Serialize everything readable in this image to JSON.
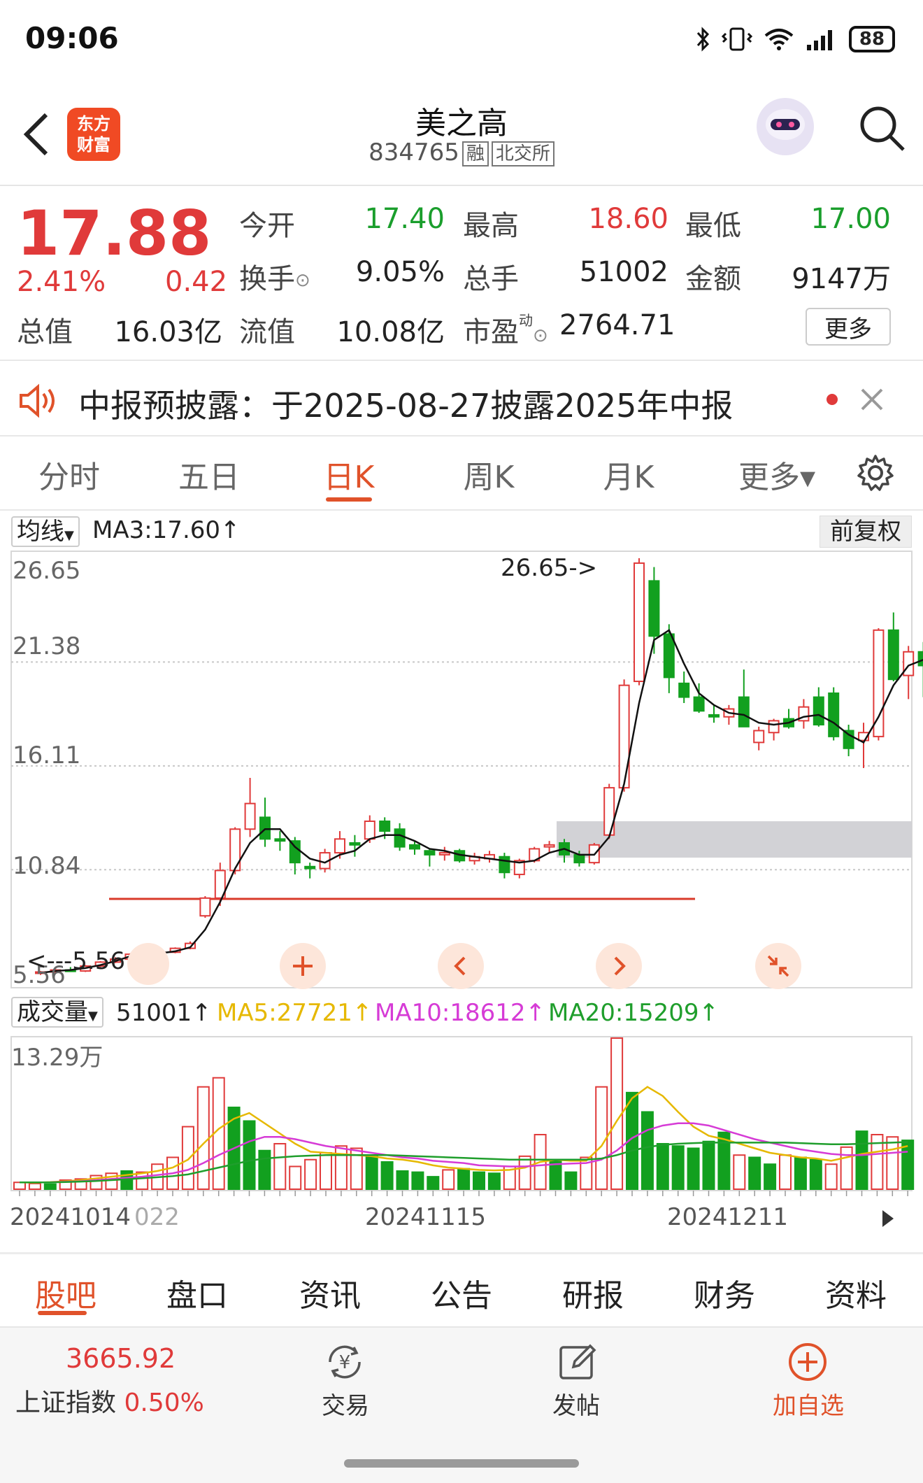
{
  "status_bar": {
    "time": "09:06",
    "battery": "88"
  },
  "header": {
    "logo_line1": "东方",
    "logo_line2": "财富",
    "stock_name": "美之高",
    "stock_code": "834765",
    "tag_margin": "融",
    "tag_exchange": "北交所"
  },
  "quote": {
    "price": "17.88",
    "change_pct": "2.41%",
    "change_abs": "0.42",
    "fields": [
      {
        "label": "今开",
        "value": "17.40",
        "color": "#1a9e2c"
      },
      {
        "label": "最高",
        "value": "18.60",
        "color": "#e03a3a"
      },
      {
        "label": "最低",
        "value": "17.00",
        "color": "#1a9e2c"
      },
      {
        "label": "换手",
        "value": "9.05%",
        "color": "#222222"
      },
      {
        "label": "总手",
        "value": "51002",
        "color": "#222222"
      },
      {
        "label": "金额",
        "value": "9147万",
        "color": "#222222"
      }
    ],
    "total_value_label": "总值",
    "total_value": "16.03亿",
    "float_value_label": "流值",
    "float_value": "10.08亿",
    "pe_label": "市盈",
    "pe_sup": "动",
    "pe_value": "2764.71",
    "more_label": "更多"
  },
  "notice": {
    "text": "中报预披露：于2025-08-27披露2025年中报"
  },
  "period_tabs": [
    "分时",
    "五日",
    "日K",
    "周K",
    "月K",
    "更多▾"
  ],
  "active_period": "日K",
  "chart_header": {
    "ma_selector": "均线",
    "ma3_text": "MA3:17.60↑",
    "fq_label": "前复权"
  },
  "chart_data": {
    "type": "candlestick",
    "y_ticks": [
      "26.65",
      "21.38",
      "16.11",
      "10.84",
      "5.56"
    ],
    "ylim": [
      5.56,
      26.65
    ],
    "max_annotation": "26.65->",
    "min_annotation": "<---5.56",
    "x_labels": [
      "20241014",
      "022",
      "20241115",
      "20241211"
    ],
    "candles": [
      [
        5.6,
        5.7,
        5.5,
        5.65
      ],
      [
        5.65,
        5.8,
        5.6,
        5.75
      ],
      [
        5.75,
        5.9,
        5.7,
        5.7
      ],
      [
        5.7,
        6.0,
        5.65,
        5.95
      ],
      [
        5.95,
        6.2,
        5.9,
        6.15
      ],
      [
        6.15,
        6.4,
        6.1,
        6.3
      ],
      [
        6.3,
        6.6,
        6.25,
        6.55
      ],
      [
        6.55,
        6.8,
        6.4,
        6.5
      ],
      [
        6.5,
        6.7,
        6.4,
        6.65
      ],
      [
        6.65,
        6.9,
        6.6,
        6.85
      ],
      [
        6.85,
        7.2,
        6.8,
        7.1
      ],
      [
        8.5,
        9.5,
        8.4,
        9.4
      ],
      [
        9.4,
        11.2,
        9.0,
        10.8
      ],
      [
        10.8,
        13.0,
        10.6,
        12.9
      ],
      [
        12.9,
        15.5,
        12.5,
        14.2
      ],
      [
        13.5,
        14.5,
        12.0,
        12.4
      ],
      [
        12.4,
        12.8,
        11.8,
        12.3
      ],
      [
        12.3,
        12.5,
        10.6,
        11.2
      ],
      [
        11.0,
        11.2,
        10.4,
        10.9
      ],
      [
        10.9,
        11.9,
        10.7,
        11.7
      ],
      [
        11.7,
        12.8,
        11.4,
        12.4
      ],
      [
        12.2,
        12.6,
        11.5,
        12.1
      ],
      [
        12.4,
        13.6,
        12.2,
        13.3
      ],
      [
        13.3,
        13.5,
        12.4,
        12.8
      ],
      [
        12.9,
        13.2,
        11.8,
        12.0
      ],
      [
        12.1,
        12.3,
        11.6,
        11.9
      ],
      [
        11.8,
        11.9,
        11.0,
        11.6
      ],
      [
        11.6,
        12.0,
        11.3,
        11.7
      ],
      [
        11.8,
        11.9,
        11.2,
        11.3
      ],
      [
        11.3,
        11.7,
        11.1,
        11.5
      ],
      [
        11.4,
        11.8,
        11.2,
        11.6
      ],
      [
        11.5,
        11.7,
        10.4,
        10.7
      ],
      [
        10.6,
        11.4,
        10.4,
        11.3
      ],
      [
        11.3,
        12.0,
        11.2,
        11.9
      ],
      [
        12.0,
        12.3,
        11.7,
        12.1
      ],
      [
        12.2,
        12.4,
        11.2,
        11.6
      ],
      [
        11.6,
        11.8,
        11.0,
        11.2
      ],
      [
        11.2,
        12.2,
        11.1,
        12.1
      ],
      [
        12.6,
        15.2,
        12.4,
        15.0
      ],
      [
        15.0,
        20.5,
        14.8,
        20.2
      ],
      [
        20.4,
        26.65,
        20.2,
        26.4
      ],
      [
        25.5,
        26.2,
        21.8,
        22.7
      ],
      [
        22.8,
        23.3,
        19.8,
        20.6
      ],
      [
        20.3,
        20.9,
        19.3,
        19.6
      ],
      [
        19.6,
        20.3,
        18.8,
        18.9
      ],
      [
        18.7,
        19.2,
        18.3,
        18.6
      ],
      [
        18.6,
        19.2,
        18.2,
        19.0
      ],
      [
        19.6,
        21.0,
        18.1,
        18.1
      ],
      [
        17.3,
        18.1,
        16.9,
        17.9
      ],
      [
        17.8,
        18.5,
        17.4,
        18.4
      ],
      [
        18.5,
        19.0,
        18.0,
        18.1
      ],
      [
        18.4,
        19.5,
        18.0,
        19.1
      ],
      [
        19.6,
        20.1,
        18.1,
        18.2
      ],
      [
        19.8,
        20.1,
        17.4,
        17.6
      ],
      [
        17.9,
        18.2,
        16.6,
        17.0
      ],
      [
        17.4,
        18.3,
        16.0,
        17.8
      ],
      [
        17.6,
        23.1,
        17.4,
        23.0
      ],
      [
        23.0,
        23.9,
        20.4,
        20.5
      ],
      [
        20.7,
        22.2,
        19.5,
        21.9
      ],
      [
        21.9,
        22.4,
        19.6,
        21.2
      ],
      [
        20.8,
        21.6,
        18.9,
        21.3
      ]
    ],
    "ma_line": [
      5.6,
      5.7,
      5.75,
      5.85,
      6.0,
      6.2,
      6.45,
      6.55,
      6.6,
      6.7,
      6.9,
      7.8,
      9.2,
      10.9,
      12.2,
      12.9,
      12.9,
      12.0,
      11.4,
      11.2,
      11.6,
      11.8,
      12.4,
      12.6,
      12.6,
      12.3,
      11.9,
      11.8,
      11.6,
      11.5,
      11.4,
      11.3,
      11.2,
      11.3,
      11.7,
      11.9,
      11.6,
      11.6,
      12.5,
      15.2,
      19.3,
      22.5,
      23.0,
      21.3,
      19.8,
      19.2,
      18.8,
      18.7,
      18.3,
      18.2,
      18.3,
      18.6,
      18.7,
      18.3,
      17.7,
      17.3,
      18.6,
      20.2,
      21.2,
      21.5,
      21.0
    ],
    "volume": {
      "legend": {
        "selector": "成交量",
        "value": "51001↑",
        "ma5": "MA5:27721↑",
        "ma10": "MA10:18612↑",
        "ma20": "MA20:15209↑",
        "ma5_color": "#e6b800",
        "ma10_color": "#d63bd6",
        "ma20_color": "#1f9e2c"
      },
      "max_label": "13.29万",
      "vmax": 132900,
      "bars": [
        [
          6000,
          1
        ],
        [
          5000,
          1
        ],
        [
          4500,
          0
        ],
        [
          8000,
          1
        ],
        [
          9000,
          1
        ],
        [
          12000,
          1
        ],
        [
          14000,
          1
        ],
        [
          16000,
          0
        ],
        [
          15000,
          1
        ],
        [
          22000,
          1
        ],
        [
          28000,
          1
        ],
        [
          55000,
          1
        ],
        [
          90000,
          1
        ],
        [
          98000,
          1
        ],
        [
          72000,
          0
        ],
        [
          60000,
          0
        ],
        [
          34000,
          0
        ],
        [
          40000,
          1
        ],
        [
          20000,
          1
        ],
        [
          26000,
          1
        ],
        [
          32000,
          1
        ],
        [
          38000,
          1
        ],
        [
          36000,
          1
        ],
        [
          30000,
          0
        ],
        [
          24000,
          0
        ],
        [
          16000,
          0
        ],
        [
          15000,
          0
        ],
        [
          11000,
          0
        ],
        [
          17000,
          1
        ],
        [
          18000,
          0
        ],
        [
          15000,
          0
        ],
        [
          14000,
          0
        ],
        [
          20000,
          1
        ],
        [
          29000,
          1
        ],
        [
          48000,
          1
        ],
        [
          25000,
          0
        ],
        [
          15000,
          0
        ],
        [
          28000,
          1
        ],
        [
          90000,
          1
        ],
        [
          132900,
          1
        ],
        [
          85000,
          0
        ],
        [
          68000,
          0
        ],
        [
          40000,
          0
        ],
        [
          38000,
          0
        ],
        [
          36000,
          0
        ],
        [
          42000,
          0
        ],
        [
          50000,
          0
        ],
        [
          30000,
          1
        ],
        [
          28000,
          0
        ],
        [
          22000,
          0
        ],
        [
          30000,
          1
        ],
        [
          28000,
          0
        ],
        [
          26000,
          0
        ],
        [
          22000,
          1
        ],
        [
          37000,
          1
        ],
        [
          51001,
          0
        ],
        [
          48000,
          1
        ],
        [
          46000,
          1
        ],
        [
          43000,
          0
        ]
      ],
      "ma5": [
        6000,
        5800,
        6200,
        7000,
        8000,
        9500,
        11000,
        12500,
        14000,
        16000,
        19000,
        26000,
        40000,
        53000,
        62000,
        67000,
        58000,
        49000,
        40000,
        33000,
        32000,
        31000,
        30000,
        29000,
        27000,
        26000,
        24000,
        21000,
        19000,
        18000,
        17000,
        16500,
        17000,
        19000,
        24000,
        26000,
        25000,
        25000,
        38000,
        60000,
        80000,
        90000,
        82000,
        68000,
        55000,
        47000,
        44000,
        40000,
        36000,
        32000,
        30000,
        28000,
        27000,
        25000,
        28000,
        31000,
        33000,
        35000,
        38000
      ],
      "ma10": [
        6000,
        6000,
        6100,
        6500,
        7000,
        8000,
        9000,
        10000,
        11000,
        12500,
        14000,
        17000,
        23000,
        30000,
        36000,
        42000,
        46000,
        46000,
        44000,
        41000,
        38000,
        36000,
        34000,
        32000,
        30000,
        28000,
        27000,
        25000,
        24000,
        23000,
        21000,
        20500,
        20000,
        20000,
        21000,
        22000,
        22500,
        23000,
        26000,
        34000,
        45000,
        52000,
        56000,
        58000,
        58000,
        56000,
        52000,
        48000,
        44000,
        41000,
        38000,
        35000,
        33000,
        31000,
        30000,
        30000,
        31000,
        32000,
        33000
      ],
      "ma20": [
        6000,
        6000,
        6000,
        6300,
        6700,
        7200,
        8000,
        8800,
        9600,
        10500,
        11500,
        13000,
        16000,
        19000,
        22000,
        25000,
        27000,
        28000,
        29000,
        29500,
        30000,
        30000,
        30000,
        30000,
        30000,
        29500,
        29000,
        28500,
        28000,
        27500,
        27000,
        26500,
        26000,
        26000,
        26000,
        26000,
        26000,
        26000,
        27000,
        30000,
        34000,
        37000,
        39000,
        40000,
        40500,
        41000,
        41000,
        41000,
        41000,
        41000,
        41000,
        40500,
        40000,
        39500,
        39500,
        40000,
        40500,
        41000,
        41500
      ]
    }
  },
  "bottom_tabs": [
    "股吧",
    "盘口",
    "资讯",
    "公告",
    "研报",
    "财务",
    "资料"
  ],
  "active_bottom_tab": "股吧",
  "footer": {
    "index_value": "3665.92",
    "index_name": "上证指数",
    "index_change": "0.50%",
    "trade_label": "交易",
    "trade_symbol": "¥",
    "post_label": "发帖",
    "add_label": "加自选"
  },
  "colors": {
    "up": "#e03a3a",
    "down": "#12a01f",
    "accent": "#e0522a",
    "support_line": "#d93a2a"
  }
}
